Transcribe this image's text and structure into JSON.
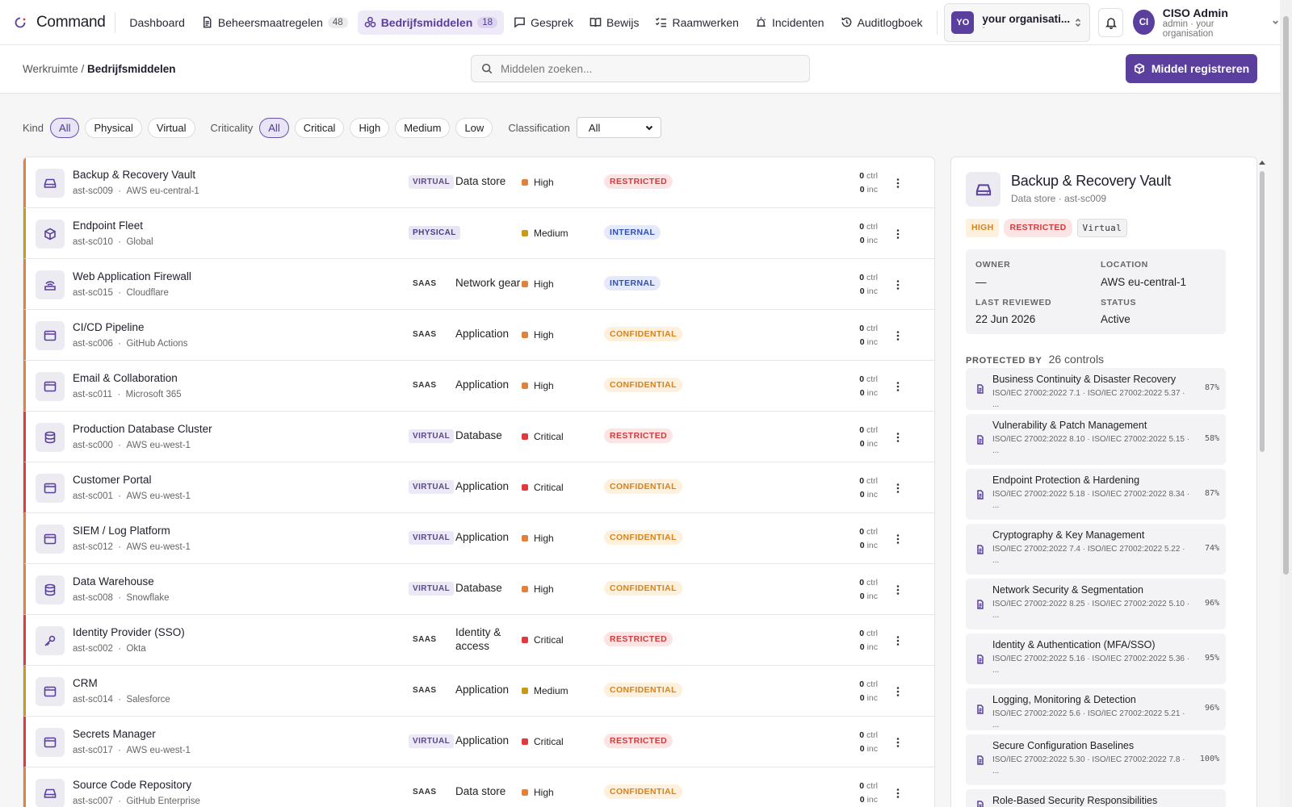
{
  "app": {
    "name": "Command"
  },
  "nav": [
    {
      "label": "Dashboard",
      "icon": "none"
    },
    {
      "label": "Beheersmaatregelen",
      "count": "48",
      "icon": "document-icon"
    },
    {
      "label": "Bedrijfsmiddelen",
      "count": "18",
      "icon": "assets-icon",
      "active": true
    },
    {
      "label": "Gesprek",
      "icon": "chat-icon"
    },
    {
      "label": "Bewijs",
      "icon": "book-icon"
    },
    {
      "label": "Raamwerken",
      "icon": "checklist-icon"
    },
    {
      "label": "Incidenten",
      "icon": "alarm-icon"
    },
    {
      "label": "Auditlogboek",
      "icon": "history-icon"
    }
  ],
  "org": {
    "avatar": "YO",
    "name": "your organisati...",
    "sub": "-"
  },
  "user": {
    "avatar": "CI",
    "name": "CISO Admin",
    "sub": "admin · your organisation"
  },
  "breadcrumb": {
    "root": "Werkruimte",
    "sep": " / ",
    "current": "Bedrijfsmiddelen"
  },
  "search": {
    "placeholder": "Middelen zoeken..."
  },
  "primary_action": {
    "label": "Middel registreren"
  },
  "filters": {
    "kind_label": "Kind",
    "kind_options": [
      "All",
      "Physical",
      "Virtual"
    ],
    "criticality_label": "Criticality",
    "criticality_options": [
      "All",
      "Critical",
      "High",
      "Medium",
      "Low"
    ],
    "classification_label": "Classification",
    "classification_value": "All"
  },
  "assets": [
    {
      "name": "Backup & Recovery Vault",
      "id": "ast-sc009",
      "location": "AWS eu-central-1",
      "kind": "VIRTUAL",
      "type": "Data store",
      "criticality": "High",
      "classification": "RESTRICTED",
      "ctrl": "0",
      "inc": "0",
      "icon": "drive-icon"
    },
    {
      "name": "Endpoint Fleet",
      "id": "ast-sc010",
      "location": "Global",
      "kind": "PHYSICAL",
      "type": "",
      "criticality": "Medium",
      "classification": "INTERNAL",
      "ctrl": "0",
      "inc": "0",
      "icon": "box-icon"
    },
    {
      "name": "Web Application Firewall",
      "id": "ast-sc015",
      "location": "Cloudflare",
      "kind": "SAAS",
      "type": "Network gear",
      "criticality": "High",
      "classification": "INTERNAL",
      "ctrl": "0",
      "inc": "0",
      "icon": "router-icon"
    },
    {
      "name": "CI/CD Pipeline",
      "id": "ast-sc006",
      "location": "GitHub Actions",
      "kind": "SAAS",
      "type": "Application",
      "criticality": "High",
      "classification": "CONFIDENTIAL",
      "ctrl": "0",
      "inc": "0",
      "icon": "window-icon"
    },
    {
      "name": "Email & Collaboration",
      "id": "ast-sc011",
      "location": "Microsoft 365",
      "kind": "SAAS",
      "type": "Application",
      "criticality": "High",
      "classification": "CONFIDENTIAL",
      "ctrl": "0",
      "inc": "0",
      "icon": "window-icon"
    },
    {
      "name": "Production Database Cluster",
      "id": "ast-sc000",
      "location": "AWS eu-west-1",
      "kind": "VIRTUAL",
      "type": "Database",
      "criticality": "Critical",
      "classification": "RESTRICTED",
      "ctrl": "0",
      "inc": "0",
      "icon": "database-icon"
    },
    {
      "name": "Customer Portal",
      "id": "ast-sc001",
      "location": "AWS eu-west-1",
      "kind": "VIRTUAL",
      "type": "Application",
      "criticality": "Critical",
      "classification": "CONFIDENTIAL",
      "ctrl": "0",
      "inc": "0",
      "icon": "window-icon"
    },
    {
      "name": "SIEM / Log Platform",
      "id": "ast-sc012",
      "location": "AWS eu-west-1",
      "kind": "VIRTUAL",
      "type": "Application",
      "criticality": "High",
      "classification": "CONFIDENTIAL",
      "ctrl": "0",
      "inc": "0",
      "icon": "window-icon"
    },
    {
      "name": "Data Warehouse",
      "id": "ast-sc008",
      "location": "Snowflake",
      "kind": "VIRTUAL",
      "type": "Database",
      "criticality": "High",
      "classification": "CONFIDENTIAL",
      "ctrl": "0",
      "inc": "0",
      "icon": "database-icon"
    },
    {
      "name": "Identity Provider (SSO)",
      "id": "ast-sc002",
      "location": "Okta",
      "kind": "SAAS",
      "type": "Identity & access",
      "criticality": "Critical",
      "classification": "RESTRICTED",
      "ctrl": "0",
      "inc": "0",
      "icon": "key-icon"
    },
    {
      "name": "CRM",
      "id": "ast-sc014",
      "location": "Salesforce",
      "kind": "SAAS",
      "type": "Application",
      "criticality": "Medium",
      "classification": "CONFIDENTIAL",
      "ctrl": "0",
      "inc": "0",
      "icon": "window-icon"
    },
    {
      "name": "Secrets Manager",
      "id": "ast-sc017",
      "location": "AWS eu-west-1",
      "kind": "VIRTUAL",
      "type": "Application",
      "criticality": "Critical",
      "classification": "RESTRICTED",
      "ctrl": "0",
      "inc": "0",
      "icon": "window-icon"
    },
    {
      "name": "Source Code Repository",
      "id": "ast-sc007",
      "location": "GitHub Enterprise",
      "kind": "SAAS",
      "type": "Data store",
      "criticality": "High",
      "classification": "CONFIDENTIAL",
      "ctrl": "0",
      "inc": "0",
      "icon": "drive-icon"
    }
  ],
  "counter_labels": {
    "ctrl": "ctrl",
    "inc": "inc"
  },
  "colors": {
    "accent": "#5b3f9e",
    "critical": "#e0393e",
    "high": "#e0823b",
    "medium": "#c79a18",
    "low": "#5a9a3a"
  },
  "detail": {
    "title": "Backup & Recovery Vault",
    "subtitle": "Data store · ast-sc009",
    "tags": {
      "criticality": "HIGH",
      "classification": "RESTRICTED",
      "kind": "Virtual"
    },
    "owner_label": "OWNER",
    "owner": "—",
    "location_label": "LOCATION",
    "location": "AWS eu-central-1",
    "reviewed_label": "LAST REVIEWED",
    "reviewed": "22 Jun 2026",
    "status_label": "STATUS",
    "status": "Active",
    "protected_label": "PROTECTED BY",
    "protected_count": "26 controls",
    "controls": [
      {
        "name": "Business Continuity & Disaster Recovery",
        "refs": "ISO/IEC 27002:2022 7.1 · ISO/IEC 27002:2022 5.37 · ...",
        "pct": "87%"
      },
      {
        "name": "Vulnerability & Patch Management",
        "refs": "ISO/IEC 27002:2022 8.10 · ISO/IEC 27002:2022 5.15 · ...",
        "pct": "58%"
      },
      {
        "name": "Endpoint Protection & Hardening",
        "refs": "ISO/IEC 27002:2022 5.18 · ISO/IEC 27002:2022 8.34 · ...",
        "pct": "87%"
      },
      {
        "name": "Cryptography & Key Management",
        "refs": "ISO/IEC 27002:2022 7.4 · ISO/IEC 27002:2022 5.22 · ...",
        "pct": "74%"
      },
      {
        "name": "Network Security & Segmentation",
        "refs": "ISO/IEC 27002:2022 8.25 · ISO/IEC 27002:2022 5.10 · ...",
        "pct": "96%"
      },
      {
        "name": "Identity & Authentication (MFA/SSO)",
        "refs": "ISO/IEC 27002:2022 5.16 · ISO/IEC 27002:2022 5.36 · ...",
        "pct": "95%"
      },
      {
        "name": "Logging, Monitoring & Detection",
        "refs": "ISO/IEC 27002:2022 5.6 · ISO/IEC 27002:2022 5.21 · ...",
        "pct": "96%"
      },
      {
        "name": "Secure Configuration Baselines",
        "refs": "ISO/IEC 27002:2022 5.30 · ISO/IEC 27002:2022 7.8 · ...",
        "pct": "100%"
      },
      {
        "name": "Role-Based Security Responsibilities",
        "refs": "",
        "pct": ""
      }
    ]
  }
}
